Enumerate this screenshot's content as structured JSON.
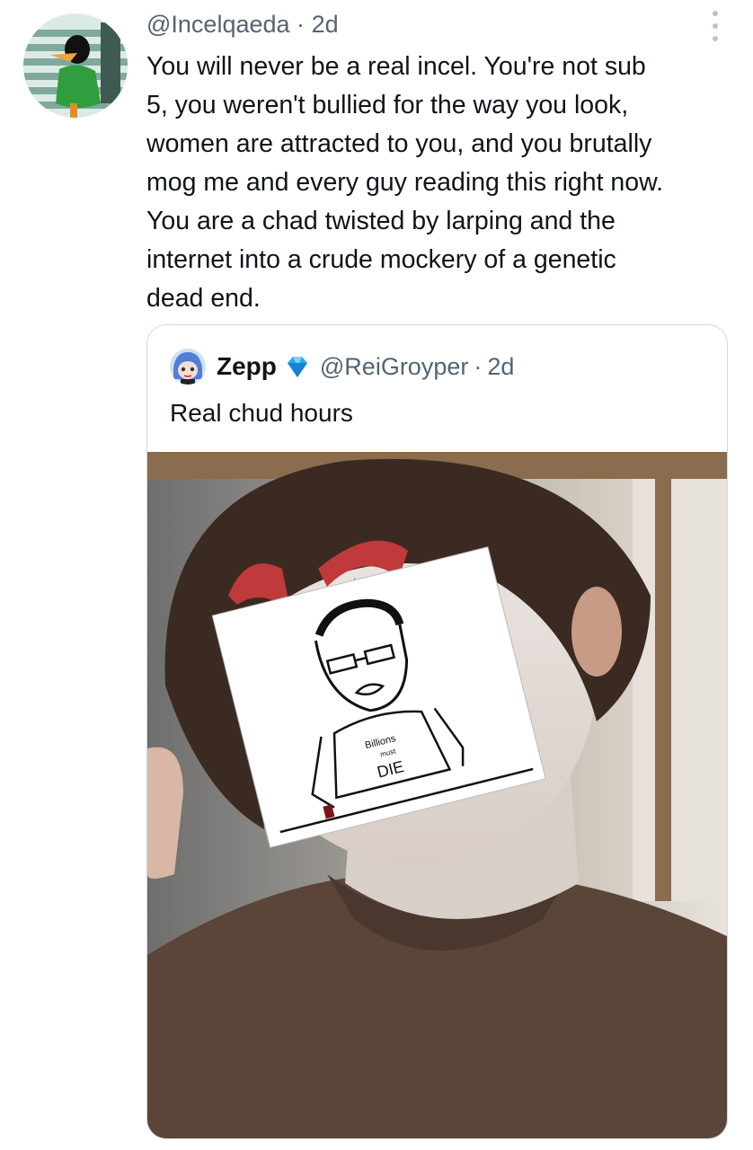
{
  "tweet": {
    "author_handle": "@Incelqaeda",
    "separator": "·",
    "time": "2d",
    "text": "You will never be a real incel. You're not sub\n5, you weren't bullied for the way you look,\nwomen are attracted to you, and you brutally\nmog me and every guy reading this right now.\nYou are a chad twisted by larping and the\ninternet into a crude mockery of a genetic\ndead end.",
    "more_icon": "vertical-ellipsis-icon"
  },
  "quoted_tweet": {
    "author_name": "Zepp",
    "badge_icon": "diamond-icon",
    "author_handle": "@ReiGroyper",
    "separator": "·",
    "time": "2d",
    "text": "Real chud hours",
    "drawing_text_top": "Billions",
    "drawing_text_mid": "must",
    "drawing_text_bottom": "DIE"
  },
  "colors": {
    "text_primary": "#0f1419",
    "text_secondary": "#536471",
    "border": "#cfd9de",
    "badge": "#1d9bf0"
  }
}
